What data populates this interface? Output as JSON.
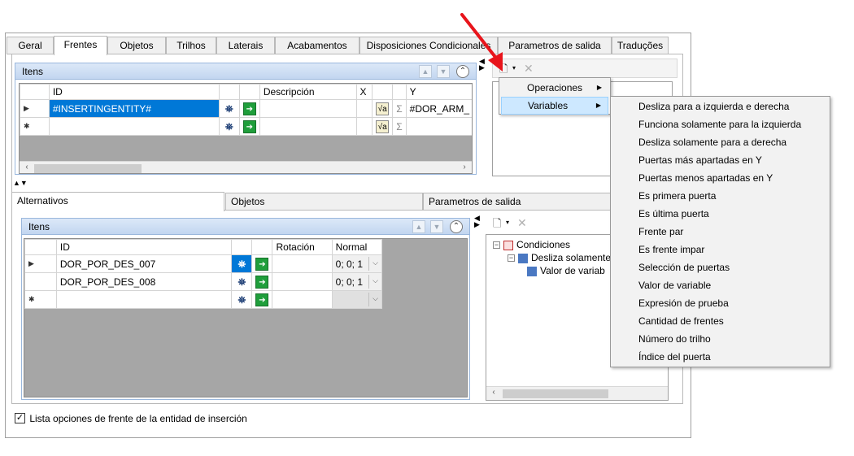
{
  "top_tabs": [
    {
      "label": "Geral"
    },
    {
      "label": "Frentes"
    },
    {
      "label": "Objetos"
    },
    {
      "label": "Trilhos"
    },
    {
      "label": "Laterais"
    },
    {
      "label": "Acabamentos"
    },
    {
      "label": "Disposiciones Condicionales"
    },
    {
      "label": "Parametros de salida"
    },
    {
      "label": "Traduções"
    }
  ],
  "active_top_tab": "Frentes",
  "items_group": {
    "title": "Itens",
    "columns": [
      "ID",
      "Descripción",
      "X",
      "Y"
    ],
    "rows": [
      {
        "marker": "▶",
        "id": "#INSERTINGENTITY#",
        "description": "",
        "x": "",
        "y": "#DOR_ARM_"
      },
      {
        "marker": "✱",
        "id": "",
        "description": "",
        "x": "",
        "y": ""
      }
    ]
  },
  "bottom_tabs": [
    {
      "label": "Alternativos"
    },
    {
      "label": "Objetos"
    },
    {
      "label": "Parametros de salida"
    }
  ],
  "alt_group": {
    "title": "Itens",
    "columns": [
      "ID",
      "Rotación",
      "Normal"
    ],
    "rows": [
      {
        "marker": "▶",
        "id": "DOR_POR_DES_007",
        "rotation": "",
        "normal": "0; 0; 1"
      },
      {
        "marker": "",
        "id": "DOR_POR_DES_008",
        "rotation": "",
        "normal": "0; 0; 1"
      },
      {
        "marker": "✱",
        "id": "",
        "rotation": "",
        "normal": ""
      }
    ]
  },
  "tree": {
    "root": "Condiciones",
    "child": "Desliza solamente",
    "grandchild": "Valor de variab"
  },
  "context_menu": {
    "items": [
      {
        "label": "Operaciones"
      },
      {
        "label": "Variables"
      }
    ]
  },
  "submenu": {
    "items": [
      "Desliza para a  izquierda e derecha",
      "Funciona solamente para la izquierda",
      "Desliza solamente para a derecha",
      "Puertas más apartadas en Y",
      "Puertas menos apartadas en Y",
      "Es primera puerta",
      "Es última puerta",
      "Frente par",
      "Es frente impar",
      "Selección de puertas",
      "Valor de variable",
      "Expresión de prueba",
      "Cantidad de frentes",
      "Número do trilho",
      "Índice del puerta"
    ]
  },
  "checkbox": {
    "label": "Lista opciones de frente de la entidad de inserción",
    "checked": true
  },
  "colors": {
    "selection": "#0078d7",
    "arrow_annotation": "#e8141b",
    "group_header": "#c2d6f0"
  }
}
